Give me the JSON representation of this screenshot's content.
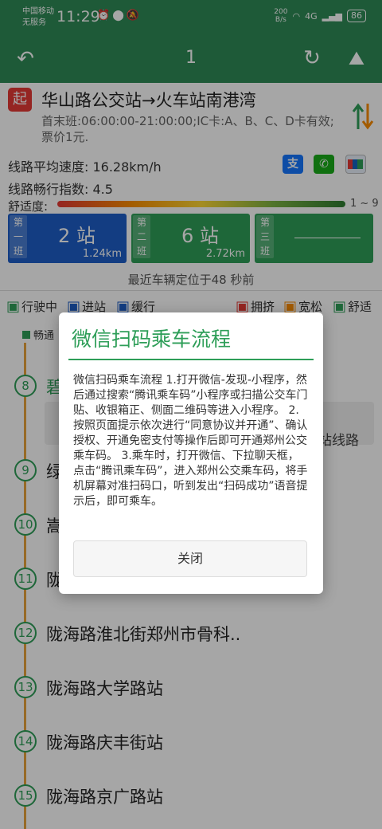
{
  "status_bar": {
    "carrier": "中国移动",
    "carrier_sub": "无服务",
    "time": "11:29",
    "net_speed_value": "200",
    "net_speed_unit": "B/s",
    "signal": "4G",
    "battery": "86"
  },
  "toolbar": {
    "title": "1"
  },
  "route": {
    "badge": "起",
    "title": "华山路公交站→火车站南港湾",
    "subtitle": "首末班:06:00:00-21:00:00;IC卡:A、B、C、D卡有效;票价1元.",
    "avg_speed": "线路平均速度: 16.28km/h",
    "smooth_index": "线路畅行指数: 4.5",
    "comfort_label": "舒适度:",
    "comfort_range": "1 ~ 9"
  },
  "payment": {
    "alipay": "支",
    "wechat": "✆",
    "unionpay": "银"
  },
  "bus_cards": [
    {
      "label": "第一班",
      "stops": "2 站",
      "distance": "1.24km"
    },
    {
      "label": "第二班",
      "stops": "6 站",
      "distance": "2.72km"
    },
    {
      "label": "第三班",
      "stops": "",
      "distance": ""
    }
  ],
  "located_text": "最近车辆定位于48 秒前",
  "legend": {
    "moving": "行驶中",
    "arriving": "进站",
    "slow": "缓行",
    "crowded": "拥挤",
    "loose": "宽松",
    "comfortable": "舒适"
  },
  "tag_smooth": "畅通",
  "stops": [
    {
      "num": "8",
      "name": "碧"
    },
    {
      "num": "9",
      "name": "绿"
    },
    {
      "num": "10",
      "name": "嵩"
    },
    {
      "num": "11",
      "name": "陇"
    },
    {
      "num": "12",
      "name": "陇海路淮北街郑州市骨科.."
    },
    {
      "num": "13",
      "name": "陇海路大学路站"
    },
    {
      "num": "14",
      "name": "陇海路庆丰街站"
    },
    {
      "num": "15",
      "name": "陇海路京广路站"
    }
  ],
  "stop_line_button": "站线路",
  "dialog": {
    "title": "微信扫码乘车流程",
    "body": "微信扫码乘车流程 1.打开微信-发现-小程序，然后通过搜索“腾讯乘车码”小程序或扫描公交车门贴、收银箱正、侧面二维码等进入小程序。 2.按照页面提示依次进行“同意协议并开通”、确认授权、开通免密支付等操作后即可开通郑州公交乘车码。 3.乘车时，打开微信、下拉聊天框，点击“腾讯乘车码”，进入郑州公交乘车码，将手机屏幕对准扫码口，听到发出“扫码成功”语音提示后，即可乘车。",
    "close_button": "关闭"
  },
  "colors": {
    "primary": "#2e8b57",
    "accent_green": "#2e9e58",
    "blue_card": "#1e5fc8",
    "line": "#e8a33c",
    "badge_red": "#e53935"
  }
}
